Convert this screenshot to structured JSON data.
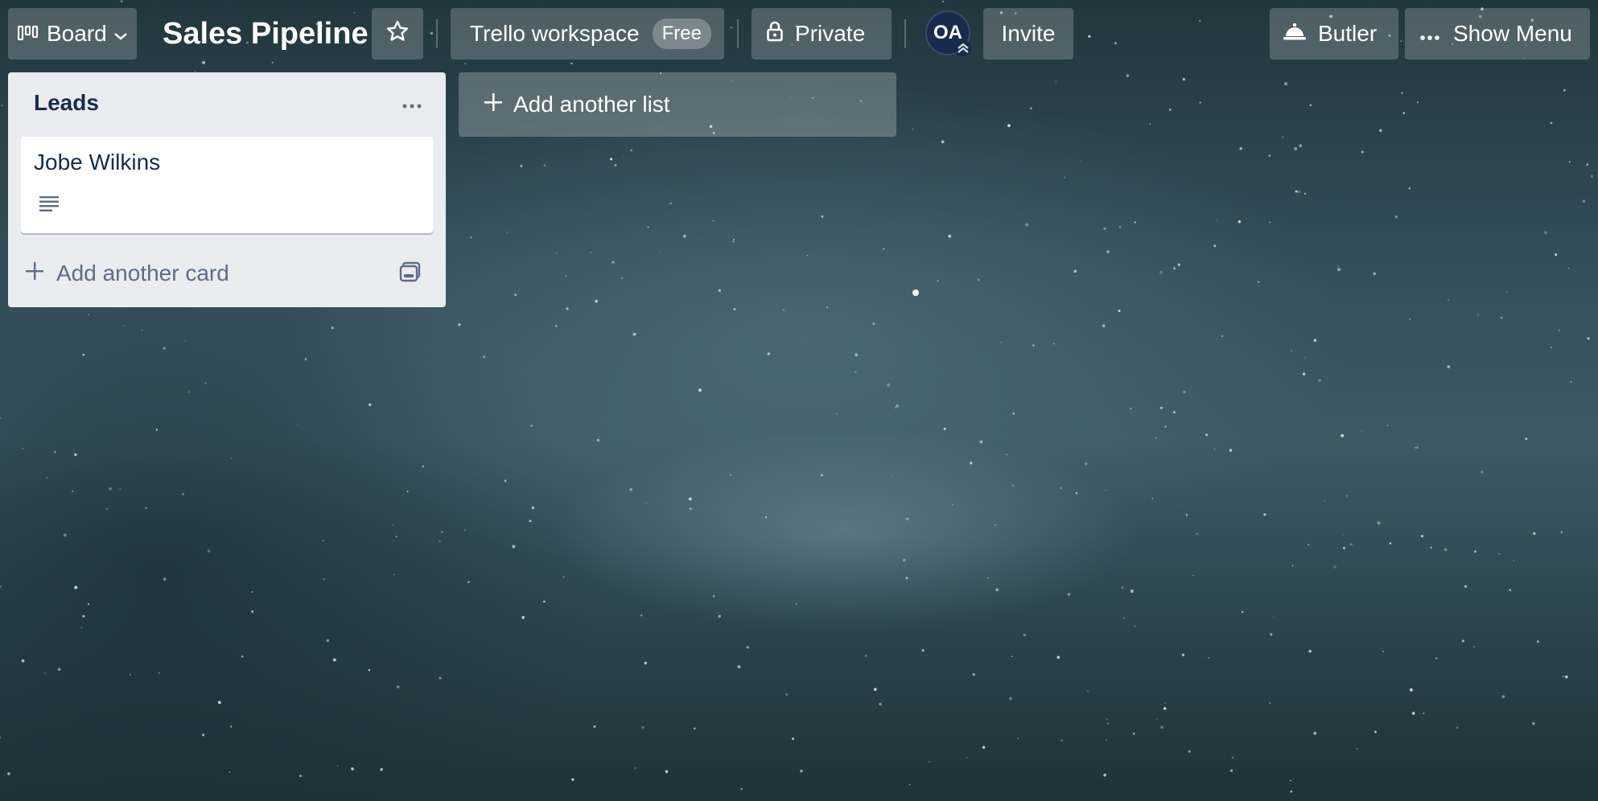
{
  "header": {
    "view_switcher_label": "Board",
    "view_switcher_icon": "board-icon",
    "board_title": "Sales Pipeline",
    "star_icon": "star-icon",
    "workspace_label": "Trello workspace",
    "workspace_badge": "Free",
    "visibility_label": "Private",
    "visibility_icon": "lock-icon",
    "member_avatar_initials": "OA",
    "member_badge_icon": "admin-chevron-icon",
    "invite_label": "Invite",
    "butler_label": "Butler",
    "butler_icon": "butler-bell-icon",
    "menu_label": "Show Menu",
    "menu_icon": "ellipsis-icon"
  },
  "lists": [
    {
      "title": "Leads",
      "cards": [
        {
          "title": "Jobe Wilkins",
          "has_description": true
        }
      ],
      "add_card_label": "Add another card"
    }
  ],
  "add_list_label": "Add another list",
  "colors": {
    "list_bg": "#ebecf0",
    "text_dark": "#172b4d",
    "text_muted": "#5e6c84",
    "avatar_bg": "#172b4d",
    "header_button_bg": "rgba(255,255,255,0.2)"
  }
}
